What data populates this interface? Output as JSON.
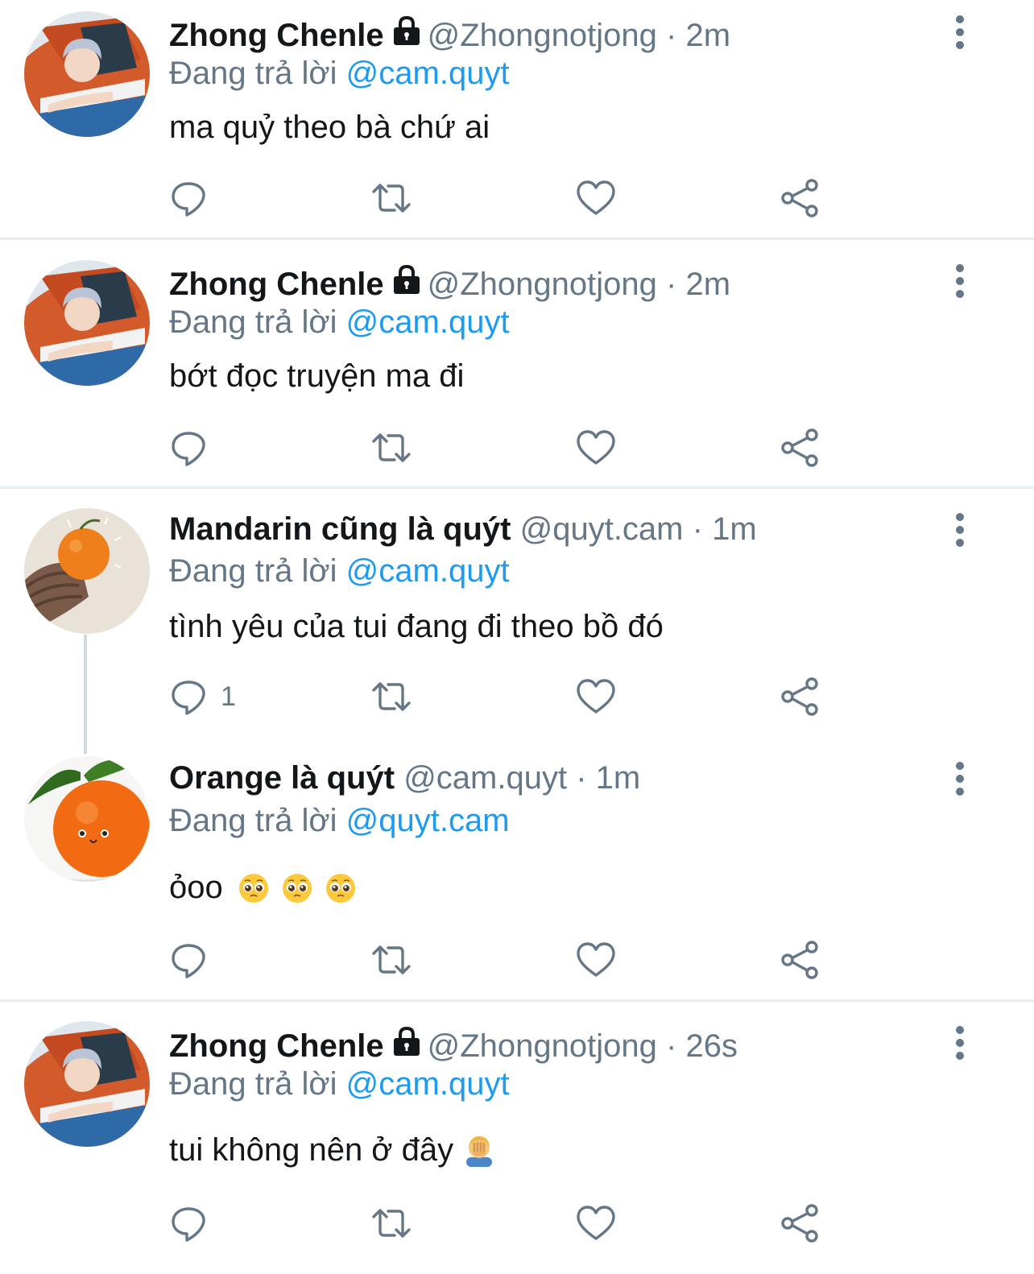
{
  "tweets": [
    {
      "name": "Zhong Chenle",
      "handle": "@Zhongnotjong",
      "time": "2m",
      "reply_label": "Đang trả lời",
      "reply_to": "@cam.quyt",
      "text": "ma quỷ theo bà chứ ai",
      "reply_count": ""
    },
    {
      "name": "Zhong Chenle",
      "handle": "@Zhongnotjong",
      "time": "2m",
      "reply_label": "Đang trả lời",
      "reply_to": "@cam.quyt",
      "text": "bớt đọc truyện ma đi",
      "reply_count": ""
    },
    {
      "name": "Mandarin cũng là quýt",
      "handle": "@quyt.cam",
      "time": "1m",
      "reply_label": "Đang trả lời",
      "reply_to": "@cam.quyt",
      "text": "tình yêu của tui đang đi theo bồ đó",
      "reply_count": "1"
    },
    {
      "name": "Orange là quýt",
      "handle": "@cam.quyt",
      "time": "1m",
      "reply_label": "Đang trả lời",
      "reply_to": "@quyt.cam",
      "text": "ỏoo",
      "reply_count": ""
    },
    {
      "name": "Zhong Chenle",
      "handle": "@Zhongnotjong",
      "time": "26s",
      "reply_label": "Đang trả lời",
      "reply_to": "@cam.quyt",
      "text": "tui không nên ở đây",
      "reply_count": ""
    }
  ],
  "separator": "·",
  "colors": {
    "accent": "#1d9bf0",
    "secondary": "#657786",
    "text": "#14171a",
    "divider": "#e6ecf0"
  },
  "icons": {
    "lock": "lock-icon",
    "reply": "reply-icon",
    "retweet": "retweet-icon",
    "like": "heart-icon",
    "share": "share-icon",
    "more": "more-vertical-icon",
    "pleading": "pleading-face-emoji",
    "facepalm": "facepalm-emoji"
  }
}
